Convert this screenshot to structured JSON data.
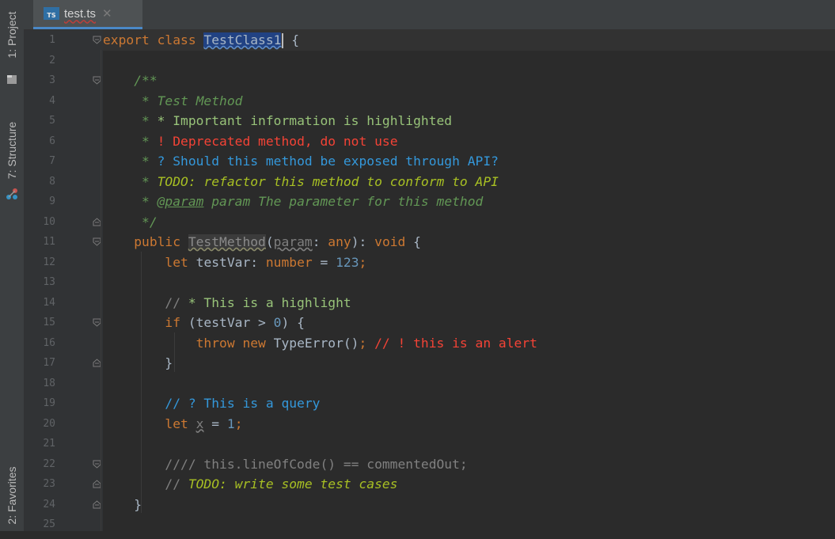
{
  "sidebar": {
    "project_label": "1: Project",
    "structure_label": "7: Structure",
    "favorites_label": "2: Favorites"
  },
  "tab": {
    "icon_text": "TS",
    "filename": "test.ts",
    "close_glyph": "✕"
  },
  "editor": {
    "line_numbers": [
      "1",
      "2",
      "3",
      "4",
      "5",
      "6",
      "7",
      "8",
      "9",
      "10",
      "11",
      "12",
      "13",
      "14",
      "15",
      "16",
      "17",
      "18",
      "19",
      "20",
      "21",
      "22",
      "23",
      "24",
      "25"
    ],
    "lines": [
      [
        {
          "t": "export class ",
          "c": "kw"
        },
        {
          "t": "TestClass1",
          "c": "cls-sel"
        },
        {
          "t": "",
          "c": "caret"
        },
        {
          "t": " {",
          "c": "plain"
        }
      ],
      [],
      [
        {
          "t": "    /**",
          "c": "doc"
        }
      ],
      [
        {
          "t": "     * Test Method",
          "c": "doc"
        }
      ],
      [
        {
          "t": "     * ",
          "c": "docstar"
        },
        {
          "t": "* Important information is highlighted",
          "c": "hl"
        }
      ],
      [
        {
          "t": "     * ",
          "c": "docstar"
        },
        {
          "t": "! Deprecated method, do not use",
          "c": "alert"
        }
      ],
      [
        {
          "t": "     * ",
          "c": "docstar"
        },
        {
          "t": "? Should this method be exposed through API?",
          "c": "query"
        }
      ],
      [
        {
          "t": "     * ",
          "c": "docstar"
        },
        {
          "t": "TODO: refactor this method to conform to API",
          "c": "todo"
        }
      ],
      [
        {
          "t": "     * ",
          "c": "docstar"
        },
        {
          "t": "@param",
          "c": "tag"
        },
        {
          "t": " param The parameter for this method",
          "c": "doc"
        }
      ],
      [
        {
          "t": "     */",
          "c": "doc"
        }
      ],
      [
        {
          "t": "    public ",
          "c": "kw"
        },
        {
          "t": "TestMethod",
          "c": "unused"
        },
        {
          "t": "(",
          "c": "plain"
        },
        {
          "t": "param",
          "c": "dim"
        },
        {
          "t": ": ",
          "c": "plain"
        },
        {
          "t": "any",
          "c": "kw"
        },
        {
          "t": "): ",
          "c": "plain"
        },
        {
          "t": "void",
          "c": "kw"
        },
        {
          "t": " {",
          "c": "plain"
        }
      ],
      [
        {
          "t": "        let ",
          "c": "kw"
        },
        {
          "t": "testVar: ",
          "c": "plain"
        },
        {
          "t": "number",
          "c": "kw"
        },
        {
          "t": " = ",
          "c": "plain"
        },
        {
          "t": "123",
          "c": "num"
        },
        {
          "t": ";",
          "c": "kw"
        }
      ],
      [],
      [
        {
          "t": "        // ",
          "c": "cmt"
        },
        {
          "t": "* This is a highlight",
          "c": "hl"
        }
      ],
      [
        {
          "t": "        if ",
          "c": "kw"
        },
        {
          "t": "(testVar > ",
          "c": "plain"
        },
        {
          "t": "0",
          "c": "num"
        },
        {
          "t": ") {",
          "c": "plain"
        }
      ],
      [
        {
          "t": "            throw new ",
          "c": "kw"
        },
        {
          "t": "TypeError()",
          "c": "plain"
        },
        {
          "t": "; ",
          "c": "kw"
        },
        {
          "t": "// ! this is an alert",
          "c": "alert"
        }
      ],
      [
        {
          "t": "        }",
          "c": "plain"
        }
      ],
      [],
      [
        {
          "t": "        // ? This is a query",
          "c": "query"
        }
      ],
      [
        {
          "t": "        let ",
          "c": "kw"
        },
        {
          "t": "x",
          "c": "dim"
        },
        {
          "t": " = ",
          "c": "plain"
        },
        {
          "t": "1",
          "c": "num"
        },
        {
          "t": ";",
          "c": "kw"
        }
      ],
      [],
      [
        {
          "t": "        //// this.lineOfCode() == commentedOut;",
          "c": "cmt"
        }
      ],
      [
        {
          "t": "        // ",
          "c": "cmt"
        },
        {
          "t": "TODO: write some test cases",
          "c": "todo"
        }
      ],
      [
        {
          "t": "    }",
          "c": "plain"
        }
      ],
      []
    ]
  },
  "colors": {
    "background": "#2b2b2b",
    "gutter": "#313335",
    "keyword": "#cc7832",
    "highlight": "#98c379",
    "alert": "#f44336",
    "query": "#3498db",
    "todo": "#a8c023",
    "doc_comment": "#629755",
    "selection": "#214283"
  }
}
